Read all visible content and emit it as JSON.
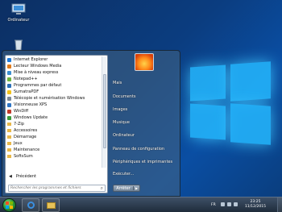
{
  "desktop": {
    "icons": [
      {
        "label": "Ordinateur",
        "icon": "computer-icon"
      },
      {
        "label": "",
        "icon": "recycle-bin-icon"
      }
    ]
  },
  "start_menu": {
    "programs": [
      {
        "label": "Internet Explorer",
        "icon": "internet-explorer-icon",
        "type": "app",
        "color": "#1f7ad8"
      },
      {
        "label": "Lecteur Windows Media",
        "icon": "windows-media-player-icon",
        "type": "app",
        "color": "#e07b1c"
      },
      {
        "label": "Mise à niveau express",
        "icon": "upgrade-icon",
        "type": "app",
        "color": "#3c8fd1"
      },
      {
        "label": "Notepad++",
        "icon": "notepad-plus-plus-icon",
        "type": "app",
        "color": "#6db33f"
      },
      {
        "label": "Programmes par défaut",
        "icon": "default-programs-icon",
        "type": "app",
        "color": "#2b6fb8"
      },
      {
        "label": "SumatraPDF",
        "icon": "sumatrapdf-icon",
        "type": "app",
        "color": "#f2c21b"
      },
      {
        "label": "Télécopie et numérisation Windows",
        "icon": "fax-scan-icon",
        "type": "app",
        "color": "#7d8a96"
      },
      {
        "label": "Visionneuse XPS",
        "icon": "xps-viewer-icon",
        "type": "app",
        "color": "#2d74c4"
      },
      {
        "label": "WinDiff",
        "icon": "windiff-icon",
        "type": "app",
        "color": "#c0392b"
      },
      {
        "label": "Windows Update",
        "icon": "windows-update-icon",
        "type": "app",
        "color": "#3a9b3a"
      },
      {
        "label": "7-Zip",
        "icon": "folder-icon",
        "type": "folder"
      },
      {
        "label": "Accessoires",
        "icon": "folder-icon",
        "type": "folder"
      },
      {
        "label": "Démarrage",
        "icon": "folder-icon",
        "type": "folder"
      },
      {
        "label": "Jeux",
        "icon": "folder-icon",
        "type": "folder"
      },
      {
        "label": "Maintenance",
        "icon": "folder-icon",
        "type": "folder"
      },
      {
        "label": "SoftsSum",
        "icon": "folder-icon",
        "type": "folder"
      }
    ],
    "back_label": "Précédent",
    "search_placeholder": "Rechercher les programmes et fichiers",
    "right_links": [
      {
        "label": "Mais",
        "name": "user-folder"
      },
      {
        "label": "Documents",
        "name": "documents"
      },
      {
        "label": "Images",
        "name": "images"
      },
      {
        "label": "Musique",
        "name": "music"
      },
      {
        "label": "Ordinateur",
        "name": "computer"
      },
      {
        "label": "Panneau de configuration",
        "name": "control-panel"
      },
      {
        "label": "Périphériques et imprimantes",
        "name": "devices-printers"
      },
      {
        "label": "Exécuter...",
        "name": "run"
      }
    ],
    "shutdown_label": "Arrêter"
  },
  "taskbar": {
    "pinned": [
      {
        "icon": "internet-explorer-icon"
      },
      {
        "icon": "file-explorer-icon"
      }
    ],
    "language": "FR",
    "time": "23:25",
    "date": "11/12/2015"
  }
}
